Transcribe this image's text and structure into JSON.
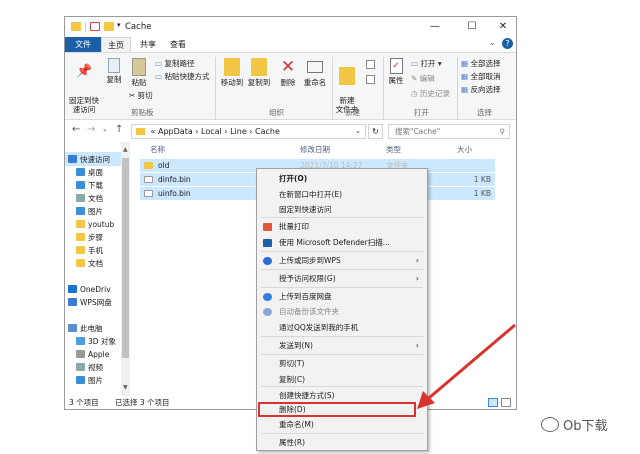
{
  "window": {
    "title": "Cache"
  },
  "ribbon": {
    "tabs": [
      "文件",
      "主页",
      "共享",
      "查看"
    ],
    "buttons": {
      "pin_quick": "固定到快\n速访问",
      "copy": "复制",
      "paste": "粘贴",
      "copy_path": "复制路径",
      "paste_shortcut": "粘贴快捷方式",
      "cut": "剪切",
      "move_to": "移动到",
      "copy_to": "复制到",
      "delete": "删除",
      "rename": "重命名",
      "new_folder": "新建\n文件夹",
      "properties": "属性",
      "open": "打开",
      "edit": "编辑",
      "history": "历史记录",
      "select_all": "全部选择",
      "select_none": "全部取消",
      "invert_select": "反向选择"
    },
    "groups": [
      "剪贴板",
      "组织",
      "新建",
      "打开",
      "选择"
    ]
  },
  "address": {
    "prefix": "«",
    "path": [
      "AppData",
      "Local",
      "Line",
      "Cache"
    ],
    "search_placeholder": "搜索\"Cache\""
  },
  "nav_pane": {
    "items": [
      "快速访问",
      "桌面",
      "下载",
      "文档",
      "图片",
      "youtub",
      "步骤",
      "手机",
      "文档",
      "OneDriv",
      "WPS网盘",
      "此电脑",
      "3D 对象",
      "Apple",
      "视频",
      "图片"
    ]
  },
  "columns": [
    "名称",
    "修改日期",
    "类型",
    "大小"
  ],
  "files": [
    {
      "name": "old",
      "date": "2021/7/10 14:27",
      "type": "文件夹",
      "size": ""
    },
    {
      "name": "dinfo.bin",
      "date": "",
      "type": "",
      "size": "1 KB"
    },
    {
      "name": "uinfo.bin",
      "date": "",
      "type": "",
      "size": "1 KB"
    }
  ],
  "status": {
    "count": "3 个项目",
    "selected": "已选择 3 个项目"
  },
  "context_menu": {
    "items": [
      {
        "label": "打开(O)",
        "bold": true
      },
      {
        "label": "在新窗口中打开(E)"
      },
      {
        "label": "固定到快速访问"
      },
      {
        "label": "批量打印"
      },
      {
        "label": "使用 Microsoft Defender扫描..."
      },
      {
        "label": "上传或同步到WPS",
        "arrow": true
      },
      {
        "label": "授予访问权限(G)",
        "arrow": true
      },
      {
        "label": "上传到百度网盘"
      },
      {
        "label": "自动备份该文件夹"
      },
      {
        "label": "通过QQ发送到我的手机"
      },
      {
        "label": "发送到(N)",
        "arrow": true
      },
      {
        "label": "剪切(T)"
      },
      {
        "label": "复制(C)"
      },
      {
        "label": "创建快捷方式(S)"
      },
      {
        "label": "删除(D)"
      },
      {
        "label": "重命名(M)"
      },
      {
        "label": "属性(R)"
      }
    ]
  },
  "watermark": "Ob下载",
  "colors": {
    "accent": "#1a5fa8",
    "selection": "#cce8ff",
    "highlight": "#d9332e",
    "folder": "#f3c644"
  }
}
